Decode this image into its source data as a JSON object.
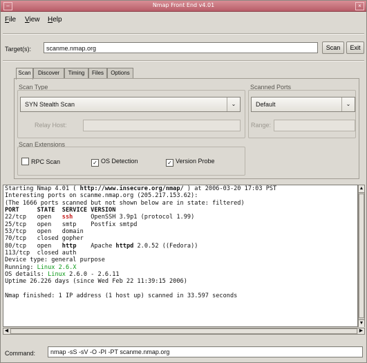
{
  "window": {
    "title": "Nmap Front End v4.01"
  },
  "menu": [
    {
      "label": "File",
      "underline": "F",
      "rest": "ile"
    },
    {
      "label": "View",
      "underline": "V",
      "rest": "iew"
    },
    {
      "label": "Help",
      "underline": "H",
      "rest": "elp"
    }
  ],
  "target": {
    "label": "Target(s):",
    "value": "scanme.nmap.org",
    "scan_button": "Scan",
    "exit_button": "Exit"
  },
  "tabs": [
    "Scan",
    "Discover",
    "Timing",
    "Files",
    "Options"
  ],
  "active_tab": "Scan",
  "scan_type": {
    "group_label": "Scan Type",
    "selected": "SYN Stealth Scan",
    "relay_host_label": "Relay Host:",
    "relay_host_value": ""
  },
  "scanned_ports": {
    "group_label": "Scanned Ports",
    "selected": "Default",
    "range_label": "Range:",
    "range_value": ""
  },
  "scan_extensions": {
    "group_label": "Scan Extensions",
    "rpc": {
      "label": "RPC Scan",
      "checked": false
    },
    "os": {
      "label": "OS Detection",
      "checked": true
    },
    "version": {
      "label": "Version Probe",
      "checked": true
    }
  },
  "output": [
    [
      {
        "t": "Starting Nmap 4.01 ( "
      },
      {
        "t": "http://www.insecure.org/nmap/",
        "c": "b"
      },
      {
        "t": " ) at 2006-03-20 17:03 PST"
      }
    ],
    [
      {
        "t": "Interesting ports on scanme.nmap.org (205.217.153.62):"
      }
    ],
    [
      {
        "t": "(The 1666 ports scanned but not shown below are in state: filtered)"
      }
    ],
    [
      {
        "t": "PORT     STATE  SERVICE VERSION",
        "c": "b"
      }
    ],
    [
      {
        "t": "22/tcp   open   "
      },
      {
        "t": "ssh",
        "c": "red"
      },
      {
        "t": "     OpenSSH 3.9p1 (protocol 1.99)"
      }
    ],
    [
      {
        "t": "25/tcp   open   smtp    Postfix smtpd"
      }
    ],
    [
      {
        "t": "53/tcp   open   domain"
      }
    ],
    [
      {
        "t": "70/tcp   closed gopher"
      }
    ],
    [
      {
        "t": "80/tcp   open   "
      },
      {
        "t": "http",
        "c": "b"
      },
      {
        "t": "    Apache "
      },
      {
        "t": "httpd",
        "c": "b"
      },
      {
        "t": " 2.0.52 ((Fedora))"
      }
    ],
    [
      {
        "t": "113/tcp  closed auth"
      }
    ],
    [
      {
        "t": "Device type: general purpose"
      }
    ],
    [
      {
        "t": "Running: "
      },
      {
        "t": "Linux 2.6.X",
        "c": "green"
      }
    ],
    [
      {
        "t": "OS details: "
      },
      {
        "t": "Linux",
        "c": "green"
      },
      {
        "t": " 2.6.0 - 2.6.11"
      }
    ],
    [
      {
        "t": "Uptime 26.226 days (since Wed Feb 22 11:39:15 2006)"
      }
    ],
    [
      {
        "t": ""
      }
    ],
    [
      {
        "t": "Nmap finished: 1 IP address (1 host up) scanned in 33.597 seconds"
      }
    ]
  ],
  "command": {
    "label": "Command:",
    "value": "nmap -sS -sV -O -PI -PT scanme.nmap.org"
  },
  "icons": {
    "window_menu": "window-menu-icon",
    "close": "close-icon",
    "dropdown": "chevron-down-icon",
    "check": "check-icon"
  }
}
